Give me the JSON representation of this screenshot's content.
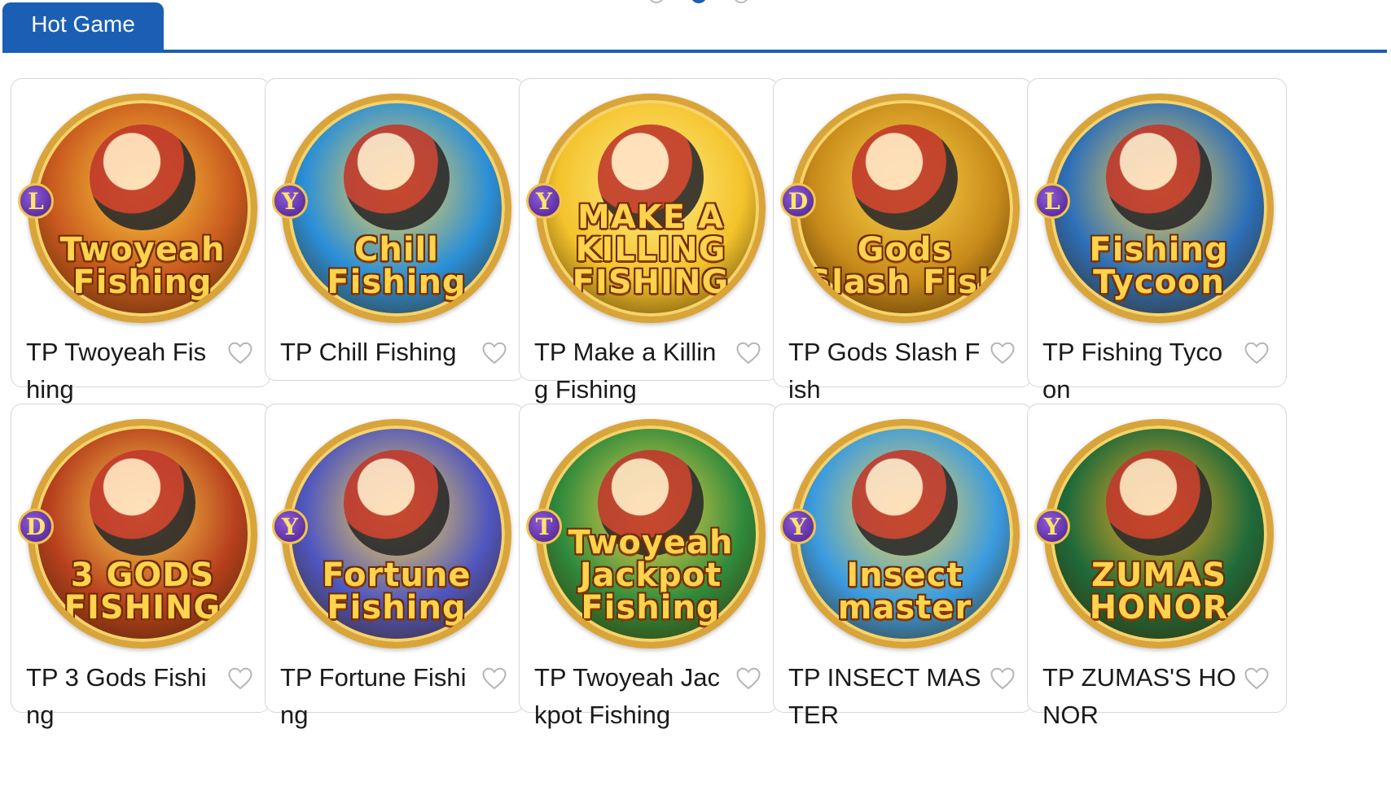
{
  "tab": {
    "label": "Hot Game"
  },
  "games": [
    {
      "title": "TP Twoyeah Fishing",
      "logo": "Twoyeah Fishing",
      "provider": "L",
      "bg": "#c8581f",
      "accent": "#ffcf3a"
    },
    {
      "title": "TP Chill Fishing",
      "logo": "Chill Fishing",
      "provider": "Y",
      "bg": "#2a8fd8",
      "accent": "#ffd34d"
    },
    {
      "title": "TP Make a Killing Fishing",
      "logo": "MAKE A KILLING FISHING",
      "provider": "Y",
      "bg": "#f4c32c",
      "accent": "#ffef8a"
    },
    {
      "title": "TP Gods Slash Fish",
      "logo": "Gods Slash Fish",
      "provider": "D",
      "bg": "#c88a1a",
      "accent": "#ffd84a"
    },
    {
      "title": "TP Fishing Tycoon",
      "logo": "Fishing Tycoon",
      "provider": "L",
      "bg": "#2c6fb8",
      "accent": "#ffd34d"
    },
    {
      "title": "TP 3 Gods Fishing",
      "logo": "3 GODS FISHING",
      "provider": "D",
      "bg": "#b8401e",
      "accent": "#ffd84a"
    },
    {
      "title": "TP Fortune Fishing",
      "logo": "Fortune Fishing",
      "provider": "Y",
      "bg": "#4f56c0",
      "accent": "#ffd84a"
    },
    {
      "title": "TP Twoyeah Jackpot Fishing",
      "logo": "Twoyeah Jackpot Fishing",
      "provider": "T",
      "bg": "#2f8a3c",
      "accent": "#ffd84a"
    },
    {
      "title": "TP INSECT MASTER",
      "logo": "Insect master",
      "provider": "Y",
      "bg": "#3a9be0",
      "accent": "#ffd84a"
    },
    {
      "title": "TP ZUMAS'S HONOR",
      "logo": "ZUMAS HONOR",
      "provider": "Y",
      "bg": "#1f6a3a",
      "accent": "#ffb020"
    }
  ],
  "icons": {
    "favorite": "heart-outline-icon"
  }
}
